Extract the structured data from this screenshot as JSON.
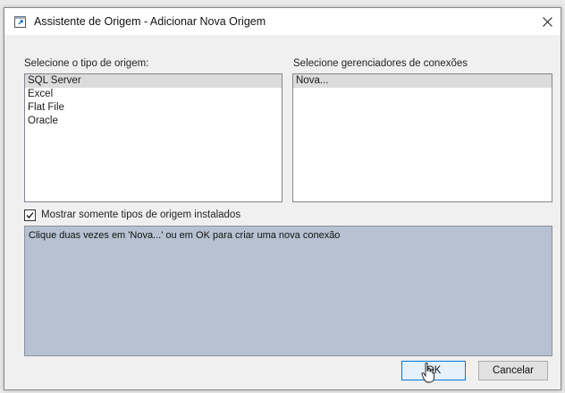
{
  "window": {
    "title": "Assistente de Origem - Adicionar Nova Origem",
    "close_label": "✕"
  },
  "source_types": {
    "label": "Selecione o tipo de origem:",
    "items": [
      "SQL Server",
      "Excel",
      "Flat File",
      "Oracle"
    ],
    "selected": "SQL Server"
  },
  "connection_managers": {
    "label": "Selecione gerenciadores de conexões",
    "items": [
      "Nova..."
    ],
    "selected": "Nova..."
  },
  "show_installed": {
    "label": "Mostrar somente tipos de origem instalados",
    "checked": true
  },
  "info_text": "Clique duas vezes em 'Nova...' ou em OK para criar uma nova conexão",
  "buttons": {
    "ok": "OK",
    "cancel": "Cancelar"
  }
}
